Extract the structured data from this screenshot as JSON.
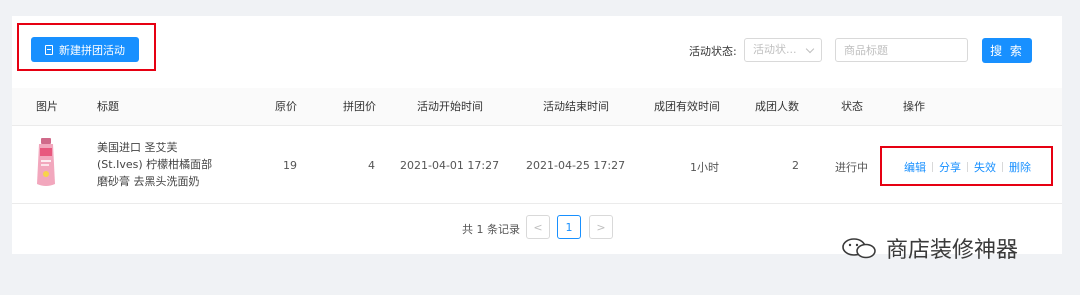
{
  "toolbar": {
    "new_button_label": "新建拼团活动"
  },
  "filters": {
    "status_label": "活动状态:",
    "status_placeholder": "活动状...",
    "product_placeholder": "商品标题",
    "search_label": "搜 索"
  },
  "table": {
    "headers": {
      "image": "图片",
      "title": "标题",
      "original_price": "原价",
      "group_price": "拼团价",
      "start_time": "活动开始时间",
      "end_time": "活动结束时间",
      "valid_time": "成团有效时间",
      "group_size": "成团人数",
      "status": "状态",
      "actions": "操作"
    },
    "rows": [
      {
        "title_lines": [
          "美国进口 圣艾芙",
          "(St.Ives) 柠檬柑橘面部",
          "磨砂膏 去黑头洗面奶"
        ],
        "original_price": "19",
        "group_price": "4",
        "start_time": "2021-04-01 17:27",
        "end_time": "2021-04-25 17:27",
        "valid_time": "1小时",
        "group_size": "2",
        "status": "进行中",
        "actions": {
          "edit": "编辑",
          "share": "分享",
          "invalidate": "失效",
          "delete": "删除"
        }
      }
    ]
  },
  "pagination": {
    "total_text": "共 1 条记录",
    "current_page": "1",
    "prev": "<",
    "next": ">"
  },
  "watermark": {
    "text": "商店装修神器"
  },
  "colors": {
    "primary": "#1890ff",
    "highlight_border": "#e60012",
    "background": "#f0f2f5"
  }
}
